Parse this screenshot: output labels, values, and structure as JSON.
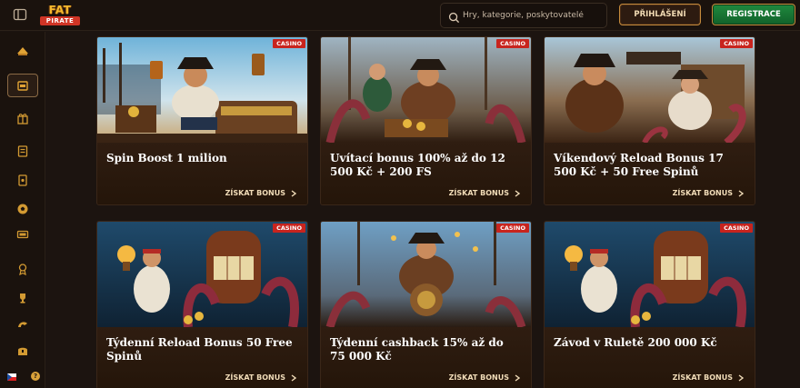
{
  "header": {
    "logo_top": "FAT",
    "logo_bottom": "PIRATE",
    "search_placeholder": "Hry, kategorie, poskytovatelé",
    "login_label": "PŘIHLÁŠENÍ",
    "register_label": "REGISTRACE"
  },
  "sidebar": {
    "items": [
      {
        "icon": "home-icon"
      },
      {
        "icon": "promotions-icon"
      },
      {
        "icon": "gift-icon"
      },
      {
        "icon": "slots-icon"
      },
      {
        "icon": "cards-icon"
      },
      {
        "icon": "sports-icon"
      },
      {
        "icon": "live-icon"
      },
      {
        "icon": "badge-icon"
      },
      {
        "icon": "trophy-icon"
      },
      {
        "icon": "wheel-icon"
      },
      {
        "icon": "chest-icon"
      }
    ],
    "help_label": "?"
  },
  "cards": [
    {
      "badge": "CASINO",
      "title": "Spin Boost 1 milion",
      "cta": "ZÍSKAT BONUS"
    },
    {
      "badge": "CASINO",
      "title": "Uvítací bonus 100% až do 12 500 Kč + 200 FS",
      "cta": "ZÍSKAT BONUS"
    },
    {
      "badge": "CASINO",
      "title": "Víkendový Reload Bonus 17 500 Kč + 50 Free Spinů",
      "cta": "ZÍSKAT BONUS"
    },
    {
      "badge": "CASINO",
      "title": "Týdenní Reload Bonus 50 Free Spinů",
      "cta": "ZÍSKAT BONUS"
    },
    {
      "badge": "CASINO",
      "title": "Týdenní cashback 15% až do 75 000 Kč",
      "cta": "ZÍSKAT BONUS"
    },
    {
      "badge": "CASINO",
      "title": "Závod v Ruletě 200 000 Kč",
      "cta": "ZÍSKAT BONUS"
    }
  ],
  "colors": {
    "accent_gold": "#d9a13a",
    "badge_red": "#c8241e",
    "register_green": "#1f8a3e",
    "background": "#1c1410"
  }
}
